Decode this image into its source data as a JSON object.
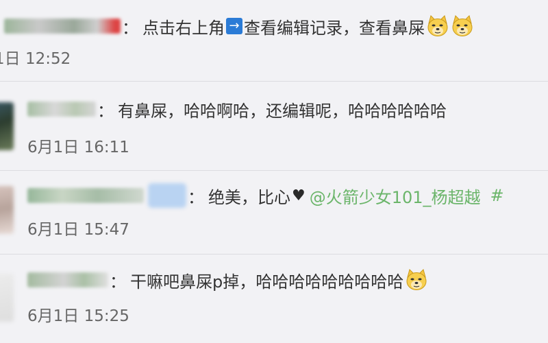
{
  "comments": [
    {
      "text_part1": "点击右上角",
      "arrow_icon": "→",
      "text_part2": "查看编辑记录，查看鼻屎",
      "emojis": [
        "doge-emoji",
        "doge-emoji"
      ],
      "time": "1日 12:52"
    },
    {
      "text": "有鼻屎，哈哈啊哈，还编辑呢，哈哈哈哈哈哈",
      "time": "6月1日 16:11"
    },
    {
      "text": "绝美，比心",
      "heart": "♥",
      "mention": "@火箭少女101_杨超越",
      "hashtag_start": "#",
      "time": "6月1日 15:47"
    },
    {
      "text": "干嘛吧鼻屎p掉，哈哈哈哈哈哈哈哈哈",
      "emojis": [
        "doge-emoji"
      ],
      "time": "6月1日 15:25"
    }
  ],
  "colors": {
    "background": "#f2f2f5",
    "text": "#333333",
    "time": "#666666",
    "mention": "#6bb56a",
    "arrow_box": "#2b7bd6"
  }
}
